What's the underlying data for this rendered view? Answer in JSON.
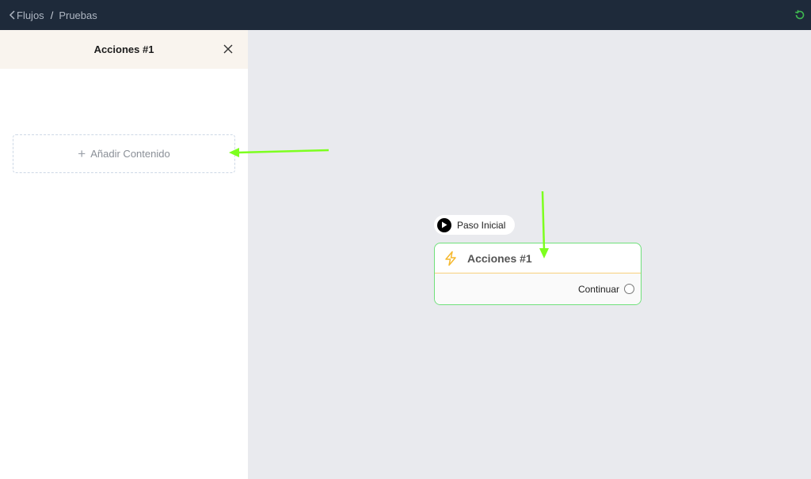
{
  "breadcrumb": {
    "parent": "Flujos",
    "separator": "/",
    "current": "Pruebas"
  },
  "sidebar": {
    "title": "Acciones #1",
    "add_content_label": "Añadir Contenido"
  },
  "canvas": {
    "start_pill": {
      "label": "Paso Inicial"
    },
    "node": {
      "title": "Acciones #1",
      "output_label": "Continuar"
    }
  },
  "colors": {
    "topbar": "#1e2a3a",
    "refresh_icon": "#3fb950",
    "node_border": "#6fe07a",
    "node_divider": "#f7cf7c",
    "bolt_icon": "#f5b82e",
    "annotation_arrow": "#7dff1f"
  },
  "icons": {
    "back": "chevron-left-icon",
    "refresh": "refresh-icon",
    "close": "close-icon",
    "add": "plus-icon",
    "start": "play-icon",
    "node": "lightning-icon",
    "output": "connector-port-icon"
  }
}
